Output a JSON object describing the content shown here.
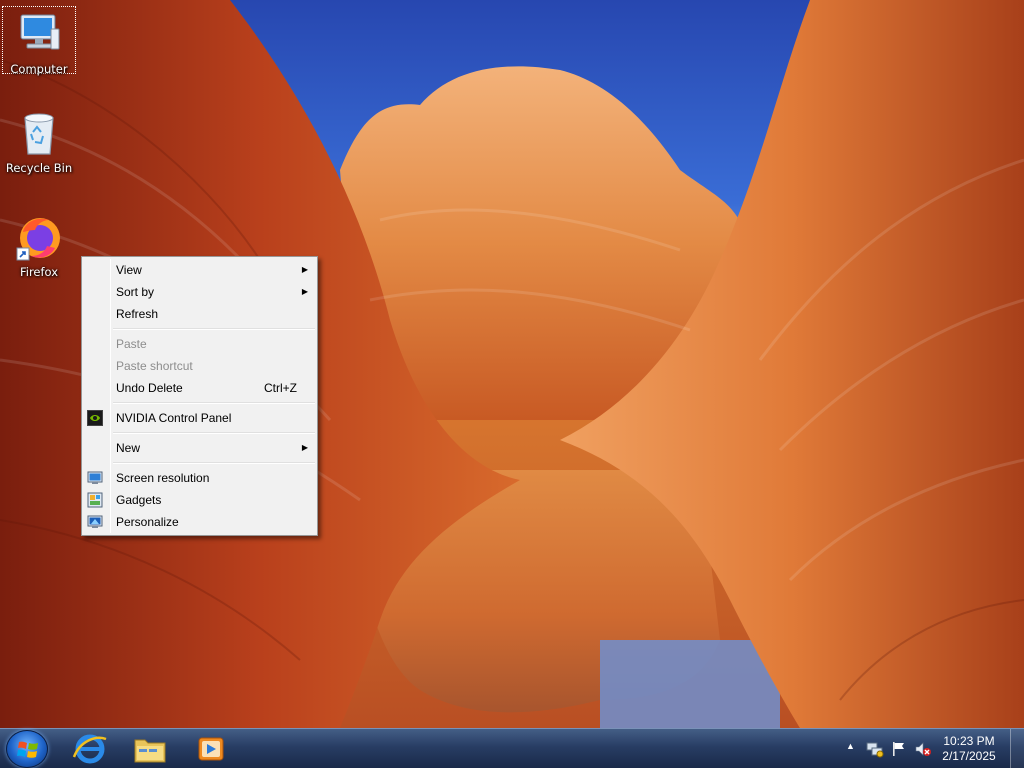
{
  "desktop": {
    "icons": [
      {
        "label": "Computer",
        "icon": "computer-icon",
        "selected": true
      },
      {
        "label": "Recycle Bin",
        "icon": "recycle-bin-icon",
        "selected": false
      },
      {
        "label": "Firefox",
        "icon": "firefox-icon",
        "selected": false
      }
    ]
  },
  "context_menu": {
    "items": [
      {
        "label": "View",
        "submenu": true
      },
      {
        "label": "Sort by",
        "submenu": true
      },
      {
        "label": "Refresh"
      },
      {
        "label": "Paste",
        "disabled": true
      },
      {
        "label": "Paste shortcut",
        "disabled": true
      },
      {
        "label": "Undo Delete",
        "shortcut": "Ctrl+Z"
      },
      {
        "label": "NVIDIA Control Panel",
        "icon": "nvidia-icon"
      },
      {
        "label": "New",
        "submenu": true
      },
      {
        "label": "Screen resolution",
        "icon": "screen-resolution-icon"
      },
      {
        "label": "Gadgets",
        "icon": "gadgets-icon"
      },
      {
        "label": "Personalize",
        "icon": "personalize-icon"
      }
    ]
  },
  "taskbar": {
    "start": {
      "icon": "windows-logo-icon"
    },
    "pinned": [
      {
        "name": "Internet Explorer",
        "icon": "internet-explorer-icon"
      },
      {
        "name": "Windows Explorer",
        "icon": "folder-icon"
      },
      {
        "name": "Windows Media Player",
        "icon": "media-player-icon"
      }
    ],
    "tray": {
      "icons": [
        "show-hidden-icons-chevron",
        "network-icon",
        "action-center-flag-icon",
        "volume-muted-icon"
      ],
      "time": "10:23 PM",
      "date": "2/17/2025"
    }
  },
  "colors": {
    "menu_bg": "#f1f1f1",
    "menu_disabled": "#8d8d8d",
    "taskbar": "#28406a",
    "sky": "#2f5cc4",
    "sandstone": "#d8772f"
  }
}
